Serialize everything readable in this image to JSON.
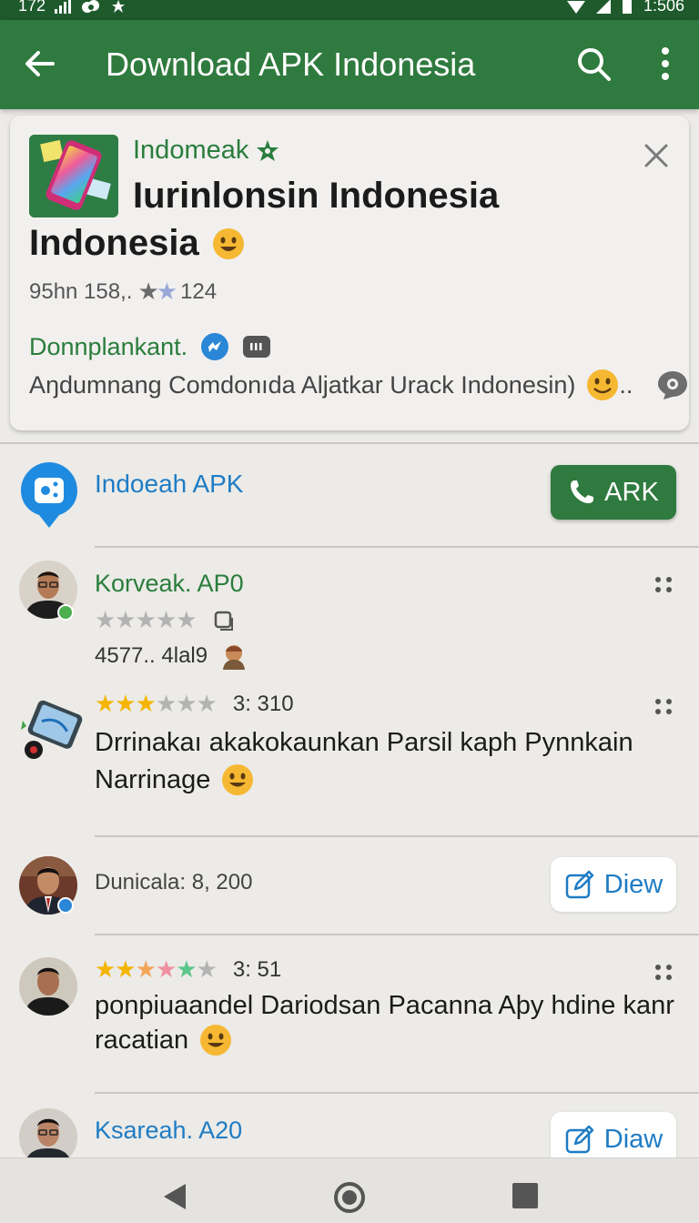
{
  "status_bar": {
    "left_text": "172",
    "time": "1:506"
  },
  "app_bar": {
    "title": "Download APK Indonesia"
  },
  "app_card": {
    "brand": "Indomeak",
    "title_line1": "Iurinlonsin Indonesia",
    "title_line2": "Indonesia",
    "meta_left": "95hn 158,.",
    "meta_right": "124",
    "download_label": "Donnplankant.",
    "description": "Aŋdumnang Comdonıda Aljatkar Urack Indonesin)",
    "description_suffix": ".."
  },
  "developer": {
    "name": "Indoeah APK",
    "button_label": "ARK"
  },
  "reviews": [
    {
      "name": "Korveak. AP0",
      "meta": "4577.. 4lal9",
      "stars": 0
    },
    {
      "meta": "3: 310",
      "stars": 3,
      "text_line1": "Drrinakaı akakokaunkan Parsil kaph Pynnkain",
      "text_line2": "Narrinage"
    },
    {
      "meta": "Dunicala: 8, 200",
      "button_label": "Diew"
    },
    {
      "meta": "3: 51",
      "stars": 3,
      "text_line1": "ponpiuaandel Dariodsan Pacanna Aþy hdine kanr",
      "text_line2": "racatian"
    },
    {
      "name": "Ksareah. A20",
      "button_label": "Diaw"
    }
  ],
  "colors": {
    "primary": "#2f7a3e",
    "status_bar": "#1e5a2c",
    "link": "#1f7cc4",
    "brand_green": "#2a7d3c",
    "star": "#f4b400"
  }
}
